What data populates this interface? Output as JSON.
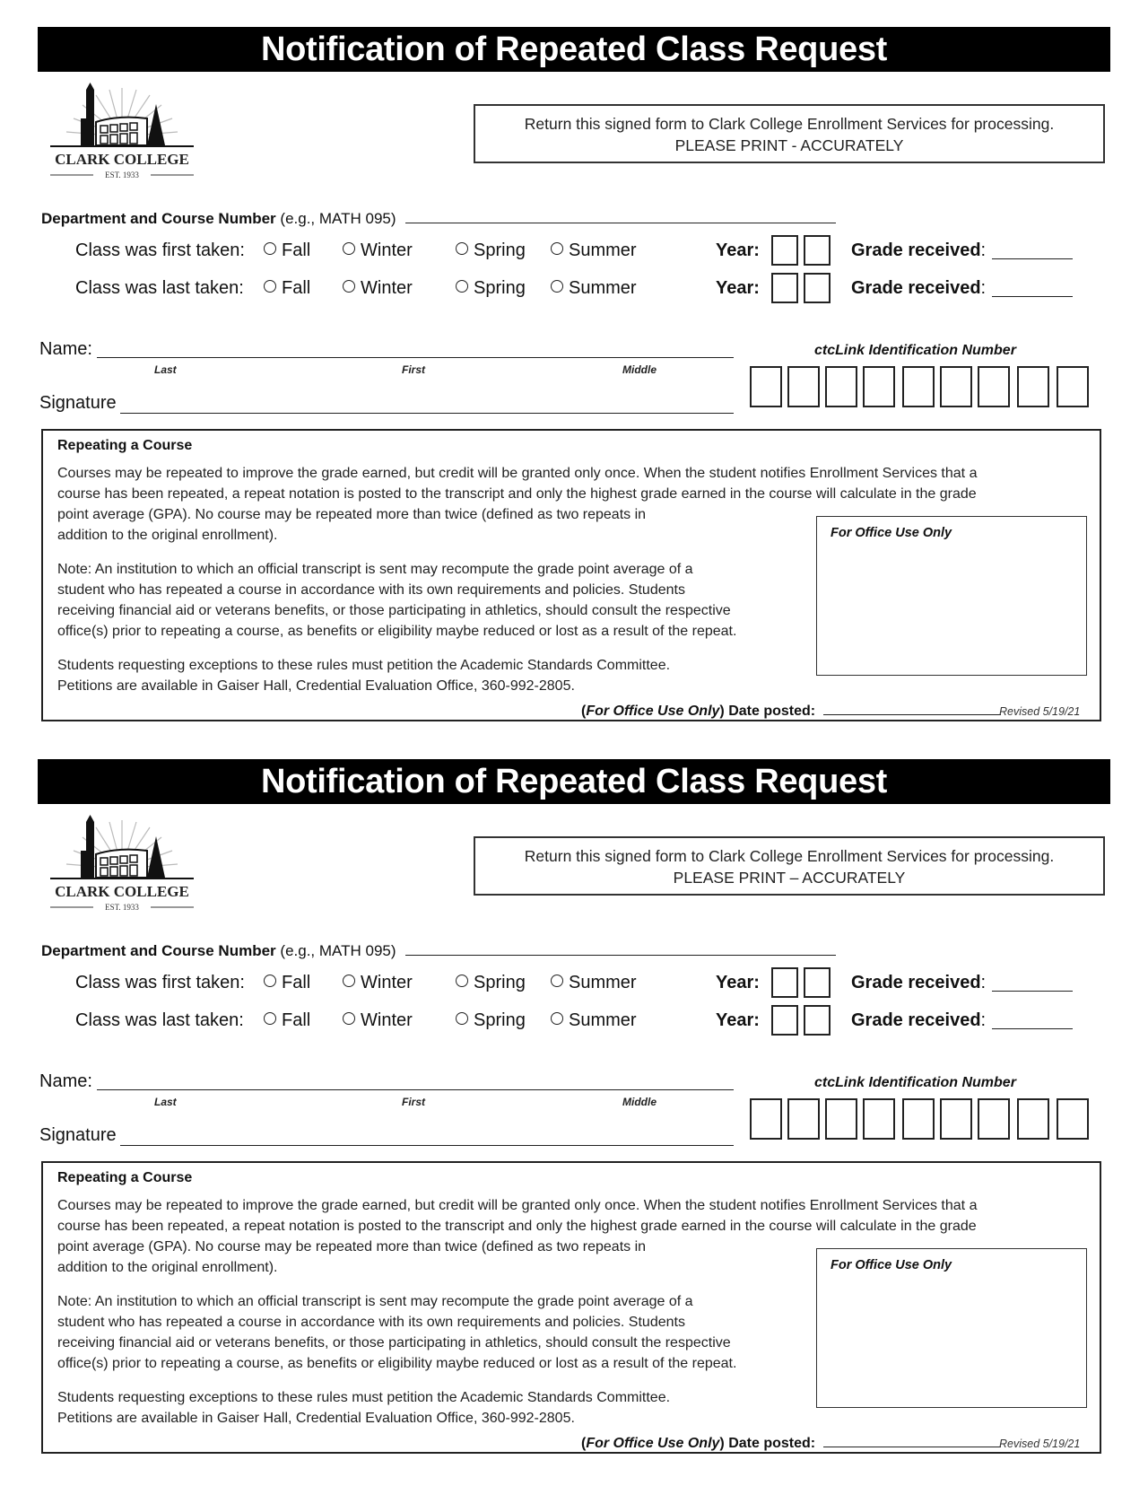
{
  "forms": [
    {
      "title": "Notification of Repeated Class Request",
      "logo": {
        "name": "CLARK COLLEGE",
        "est": "EST. 1933"
      },
      "return_box": {
        "line1": "Return this signed form to Clark College Enrollment Services for processing.",
        "line2": "PLEASE PRINT - ACCURATELY"
      },
      "dept": {
        "label": "Department and Course Number",
        "example": "(e.g., MATH 095)"
      },
      "terms": [
        {
          "label": "Class was first taken:",
          "options": [
            "Fall",
            "Winter",
            "Spring",
            "Summer"
          ],
          "year_label": "Year:",
          "grade_label": "Grade received",
          "colon": ":"
        },
        {
          "label": "Class was last taken:",
          "options": [
            "Fall",
            "Winter",
            "Spring",
            "Summer"
          ],
          "year_label": "Year:",
          "grade_label": "Grade received",
          "colon": ":"
        }
      ],
      "name": {
        "label": "Name:",
        "last": "Last",
        "first": "First",
        "middle": "Middle"
      },
      "signature_label": "Signature",
      "ctclink_label": "ctcLink Identification Number",
      "info": {
        "heading": "Repeating a Course",
        "p1a": "Courses may be repeated to improve the grade earned, but credit will be granted only once.  When the student notifies Enrollment Services that a",
        "p1b": "course has been repeated, a repeat notation is posted to the transcript and only the highest grade earned in the course will calculate in the grade",
        "p1c": "point average (GPA).  No course may be repeated more than twice (defined as two repeats in",
        "p1d": "addition to the original enrollment).",
        "p2a": "Note:  An institution to which an official transcript is sent may recompute the grade point average of a",
        "p2b": "student who has repeated a course in accordance with its own requirements and policies.  Students",
        "p2c": "receiving financial aid or veterans benefits, or those participating in athletics, should consult the respective",
        "p2d": "office(s) prior to repeating a course, as benefits or eligibility maybe reduced or lost as a result of the repeat.",
        "p3a": "Students requesting exceptions to these rules must petition the Academic Standards Committee.",
        "p3b": "Petitions are available in Gaiser Hall, Credential Evaluation Office, 360-992-2805.",
        "office_use": "For Office Use Only",
        "date_prefix_open": "(",
        "date_prefix_italic": "For Office Use Only",
        "date_prefix_close": ")",
        "date_label": "Date posted:",
        "revised": "Revised 5/19/21"
      }
    },
    {
      "title": "Notification of Repeated Class Request",
      "logo": {
        "name": "CLARK COLLEGE",
        "est": "EST. 1933"
      },
      "return_box": {
        "line1": "Return this signed form to Clark College Enrollment Services for processing.",
        "line2": "PLEASE PRINT – ACCURATELY"
      },
      "dept": {
        "label": "Department and Course Number",
        "example": "(e.g., MATH 095)"
      },
      "terms": [
        {
          "label": "Class was first taken:",
          "options": [
            "Fall",
            "Winter",
            "Spring",
            "Summer"
          ],
          "year_label": "Year:",
          "grade_label": "Grade received",
          "colon": ":"
        },
        {
          "label": "Class was last taken:",
          "options": [
            "Fall",
            "Winter",
            "Spring",
            "Summer"
          ],
          "year_label": "Year:",
          "grade_label": "Grade received",
          "colon": ":"
        }
      ],
      "name": {
        "label": "Name:",
        "last": "Last",
        "first": "First",
        "middle": "Middle"
      },
      "signature_label": "Signature",
      "ctclink_label": "ctcLink Identification Number",
      "info": {
        "heading": "Repeating a Course",
        "p1a": "Courses may be repeated to improve the grade earned, but credit will be granted only once.  When the student notifies Enrollment Services that a",
        "p1b": "course has been repeated, a repeat notation is posted to the transcript and only the highest grade earned in the course will calculate in the grade",
        "p1c": "point average (GPA).  No course may be repeated more than twice (defined as two repeats in",
        "p1d": "addition to the original enrollment).",
        "p2a": "Note:  An institution to which an official transcript is sent may recompute the grade point average of a",
        "p2b": "student who has repeated a course in accordance with its own requirements and policies.  Students",
        "p2c": "receiving financial aid or veterans benefits, or those participating in athletics, should consult the respective",
        "p2d": "office(s) prior to repeating a course, as benefits or eligibility maybe reduced or lost as a result of the repeat.",
        "p3a": "Students requesting exceptions to these rules must petition the Academic Standards Committee.",
        "p3b": "Petitions are available in Gaiser Hall, Credential Evaluation Office, 360-992-2805.",
        "office_use": "For Office Use Only",
        "date_prefix_open": "(",
        "date_prefix_italic": "For Office Use Only",
        "date_prefix_close": ")",
        "date_label": "Date posted:",
        "revised": "Revised 5/19/21"
      }
    }
  ]
}
